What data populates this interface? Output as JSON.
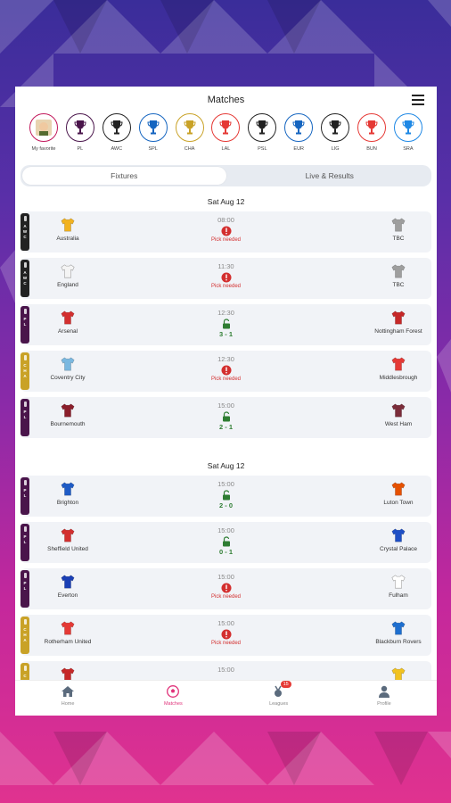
{
  "header": {
    "title": "Matches"
  },
  "leagues": [
    {
      "label": "My favorite",
      "icon": "favorite-team-icon",
      "color": "#c2185b"
    },
    {
      "label": "PL",
      "icon": "pl-trophy-icon",
      "color": "#4a154b"
    },
    {
      "label": "AWC",
      "icon": "awc-trophy-icon",
      "color": "#222222"
    },
    {
      "label": "SPL",
      "icon": "spl-trophy-icon",
      "color": "#1565c0"
    },
    {
      "label": "CHA",
      "icon": "cha-trophy-icon",
      "color": "#c9a227"
    },
    {
      "label": "LAL",
      "icon": "lal-trophy-icon",
      "color": "#e53935"
    },
    {
      "label": "PSL",
      "icon": "psl-trophy-icon",
      "color": "#222222"
    },
    {
      "label": "EUR",
      "icon": "eur-trophy-icon",
      "color": "#1565c0"
    },
    {
      "label": "LIG",
      "icon": "lig-trophy-icon",
      "color": "#222222"
    },
    {
      "label": "BUN",
      "icon": "bun-logo-icon",
      "color": "#e53935"
    },
    {
      "label": "SRA",
      "icon": "sra-trophy-icon",
      "color": "#1e88e5"
    }
  ],
  "tabs": {
    "fixtures": "Fixtures",
    "live": "Live & Results"
  },
  "sections": [
    {
      "date": "Sat Aug 12",
      "matches": [
        {
          "comp": "AWC",
          "compColor": "#222222",
          "home": "Australia",
          "homeShirt": "#f2b21f",
          "away": "TBC",
          "awayShirt": "#9e9e9e",
          "time": "08:00",
          "status": "pick",
          "statusText": "Pick needed"
        },
        {
          "comp": "AWC",
          "compColor": "#222222",
          "home": "England",
          "homeShirt": "#f4f4f4",
          "away": "TBC",
          "awayShirt": "#9e9e9e",
          "time": "11:30",
          "status": "pick",
          "statusText": "Pick needed"
        },
        {
          "comp": "PL",
          "compColor": "#4a154b",
          "home": "Arsenal",
          "homeShirt": "#d32f2f",
          "away": "Nottingham Forest",
          "awayShirt": "#c62828",
          "time": "12:30",
          "status": "score",
          "statusText": "3 - 1"
        },
        {
          "comp": "CHA",
          "compColor": "#c9a227",
          "home": "Coventry City",
          "homeShirt": "#7ab8e0",
          "away": "Middlesbrough",
          "awayShirt": "#e53935",
          "time": "12:30",
          "status": "pick",
          "statusText": "Pick needed"
        },
        {
          "comp": "PL",
          "compColor": "#4a154b",
          "home": "Bournemouth",
          "homeShirt": "#8b1e2b",
          "away": "West Ham",
          "awayShirt": "#7b2c3a",
          "time": "15:00",
          "status": "score",
          "statusText": "2 - 1"
        }
      ]
    },
    {
      "date": "Sat Aug 12",
      "matches": [
        {
          "comp": "PL",
          "compColor": "#4a154b",
          "home": "Brighton",
          "homeShirt": "#1e5bc6",
          "away": "Luton Town",
          "awayShirt": "#e65100",
          "time": "15:00",
          "status": "score",
          "statusText": "2 - 0"
        },
        {
          "comp": "PL",
          "compColor": "#4a154b",
          "home": "Sheffield United",
          "homeShirt": "#d32f2f",
          "away": "Crystal Palace",
          "awayShirt": "#1e4fc6",
          "time": "15:00",
          "status": "score",
          "statusText": "0 - 1"
        },
        {
          "comp": "PL",
          "compColor": "#4a154b",
          "home": "Everton",
          "homeShirt": "#1a3fb5",
          "away": "Fulham",
          "awayShirt": "#ffffff",
          "time": "15:00",
          "status": "pick",
          "statusText": "Pick needed"
        },
        {
          "comp": "CHA",
          "compColor": "#c9a227",
          "home": "Rotherham United",
          "homeShirt": "#e53935",
          "away": "Blackburn Rovers",
          "awayShirt": "#1e6fd0",
          "time": "15:00",
          "status": "pick",
          "statusText": "Pick needed"
        },
        {
          "comp": "CHA",
          "compColor": "#c9a227",
          "home": "",
          "homeShirt": "#c62828",
          "away": "",
          "awayShirt": "#f2c21f",
          "time": "15:00",
          "status": "none",
          "statusText": ""
        }
      ]
    }
  ],
  "nav": [
    {
      "label": "Home",
      "icon": "home-icon"
    },
    {
      "label": "Matches",
      "icon": "football-icon",
      "active": true
    },
    {
      "label": "Leagues",
      "icon": "leagues-icon",
      "badge": "15"
    },
    {
      "label": "Profile",
      "icon": "profile-icon"
    }
  ],
  "colors": {
    "pick": "#d32f2f",
    "score": "#2e7d32",
    "active": "#e0327a"
  }
}
